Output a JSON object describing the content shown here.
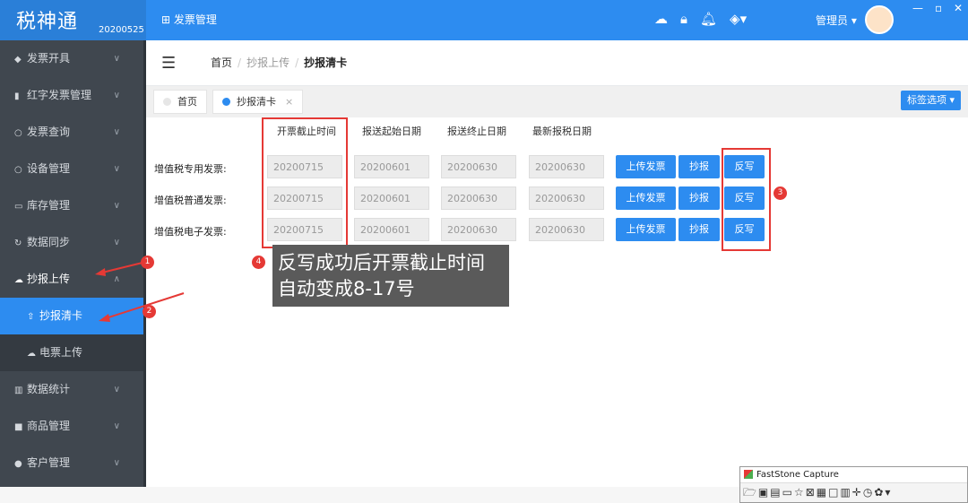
{
  "brand": {
    "title": "税神通",
    "date": "20200525"
  },
  "topbar": {
    "menu_icon": "grid-icon",
    "menu": "发票管理",
    "admin": "管理员"
  },
  "sidebar": {
    "items": [
      {
        "icon": "cube-icon",
        "label": "发票开具"
      },
      {
        "icon": "trash-icon",
        "label": "红字发票管理"
      },
      {
        "icon": "search-icon",
        "label": "发票查询"
      },
      {
        "icon": "search-icon",
        "label": "设备管理"
      },
      {
        "icon": "box-icon",
        "label": "库存管理"
      },
      {
        "icon": "sync-icon",
        "label": "数据同步"
      },
      {
        "icon": "cloud-upload-icon",
        "label": "抄报上传"
      },
      {
        "icon": "bar-chart-icon",
        "label": "数据统计"
      },
      {
        "icon": "store-icon",
        "label": "商品管理"
      },
      {
        "icon": "user-icon",
        "label": "客户管理"
      }
    ],
    "subitems": [
      {
        "icon": "upload-icon",
        "label": "抄报清卡"
      },
      {
        "icon": "cloud-icon",
        "label": "电票上传"
      }
    ]
  },
  "breadcrumb": {
    "home": "首页",
    "parent": "抄报上传",
    "current": "抄报清卡"
  },
  "tabs": {
    "home": "首页",
    "active": "抄报清卡",
    "options": "标签选项"
  },
  "table": {
    "headers": [
      "开票截止时间",
      "报送起始日期",
      "报送终止日期",
      "最新报税日期"
    ],
    "rows": [
      {
        "label": "增值税专用发票:",
        "deadline": "20200715",
        "start": "20200601",
        "end": "20200630",
        "latest": "20200630"
      },
      {
        "label": "增值税普通发票:",
        "deadline": "20200715",
        "start": "20200601",
        "end": "20200630",
        "latest": "20200630"
      },
      {
        "label": "增值税电子发票:",
        "deadline": "20200715",
        "start": "20200601",
        "end": "20200630",
        "latest": "20200630"
      }
    ],
    "buttons": {
      "upload": "上传发票",
      "report": "抄报",
      "writeback": "反写"
    }
  },
  "annotations": {
    "badges": [
      "1",
      "2",
      "3",
      "4"
    ],
    "tooltip": [
      "反写成功后开票截止时间",
      "自动变成8-17号"
    ]
  },
  "faststone": {
    "title": "FastStone Capture"
  }
}
